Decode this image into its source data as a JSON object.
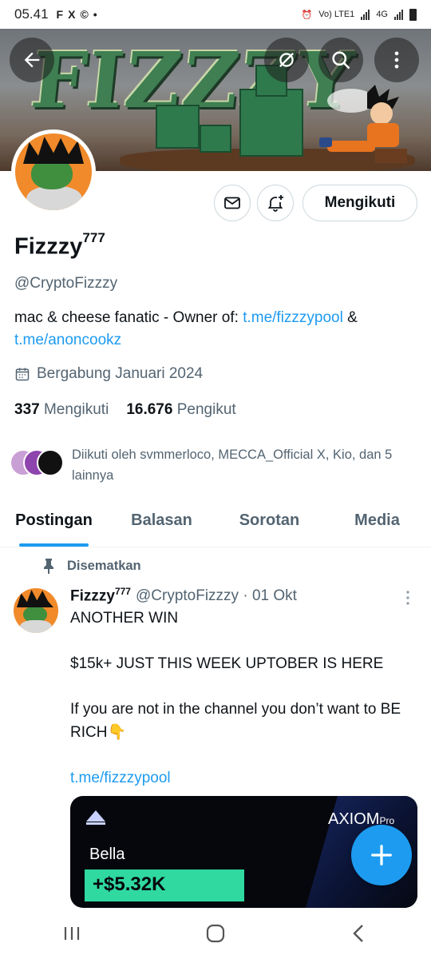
{
  "status_bar": {
    "time": "05.41",
    "app_icons": [
      "F",
      "X",
      "©",
      "•"
    ],
    "network_labels": [
      "Vo)",
      "LTE1",
      "4G"
    ]
  },
  "banner": {
    "title": "FIZZZY"
  },
  "profile": {
    "follow_label": "Mengikuti",
    "name": "Fizzzy",
    "name_superscript": "777",
    "handle": "@CryptoFizzzy",
    "bio_text": "mac & cheese fanatic - Owner of: ",
    "bio_link1": "t.me/fizzzypool",
    "bio_sep": " & ",
    "bio_link2": "t.me/anoncookz",
    "joined": "Bergabung Januari 2024",
    "following_count": "337",
    "following_label": "Mengikuti",
    "followers_count": "16.676",
    "followers_label": "Pengikut",
    "followed_by": "Diikuti oleh svmmerloco, MECCA_Official X, Kio, dan 5 lainnya"
  },
  "tabs": [
    {
      "label": "Postingan",
      "active": true
    },
    {
      "label": "Balasan",
      "active": false
    },
    {
      "label": "Sorotan",
      "active": false
    },
    {
      "label": "Media",
      "active": false
    }
  ],
  "post": {
    "pinned_label": "Disematkan",
    "author_name": "Fizzzy",
    "author_superscript": "777",
    "meta": "@CryptoFizzzy · 01 Okt",
    "lines": [
      "ANOTHER WIN",
      "",
      "$15k+ JUST THIS WEEK UPTOBER IS HERE",
      "",
      "If you are not in the channel you don’t want to BE RICH👇",
      ""
    ],
    "link": "t.me/fizzzypool",
    "media": {
      "brand": "AXIOM",
      "brand_suffix": "Pro",
      "user": "Bella",
      "pnl": "+$5.32K"
    }
  },
  "colors": {
    "accent": "#1d9bf0",
    "pnl_green": "#2fd9a0",
    "avatar_orange": "#f08a2a"
  },
  "icons": [
    "back-arrow-icon",
    "no-filter-icon",
    "search-icon",
    "more-vertical-icon",
    "mail-icon",
    "bell-plus-icon",
    "calendar-icon",
    "pin-icon",
    "plus-icon",
    "recent-apps-icon",
    "home-icon",
    "back-nav-icon"
  ]
}
